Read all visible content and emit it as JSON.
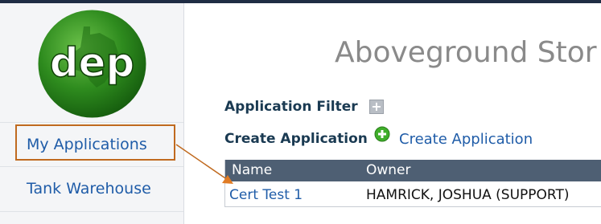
{
  "sidebar": {
    "logo_text": "dep",
    "items": [
      {
        "label": "My Applications"
      },
      {
        "label": "Tank Warehouse"
      }
    ]
  },
  "main": {
    "title": "Aboveground Stor",
    "filter_label": "Application Filter",
    "create_label": "Create Application",
    "create_link": "Create Application",
    "table": {
      "headers": [
        "Name",
        "Owner"
      ],
      "rows": [
        {
          "name": "Cert Test 1",
          "owner": "HAMRICK, JOSHUA (SUPPORT)"
        }
      ]
    }
  },
  "colors": {
    "link": "#1f5ca8",
    "header_bg": "#4e5f73",
    "annotation": "#c06a1f",
    "logo_green": "#2e8b1e"
  }
}
